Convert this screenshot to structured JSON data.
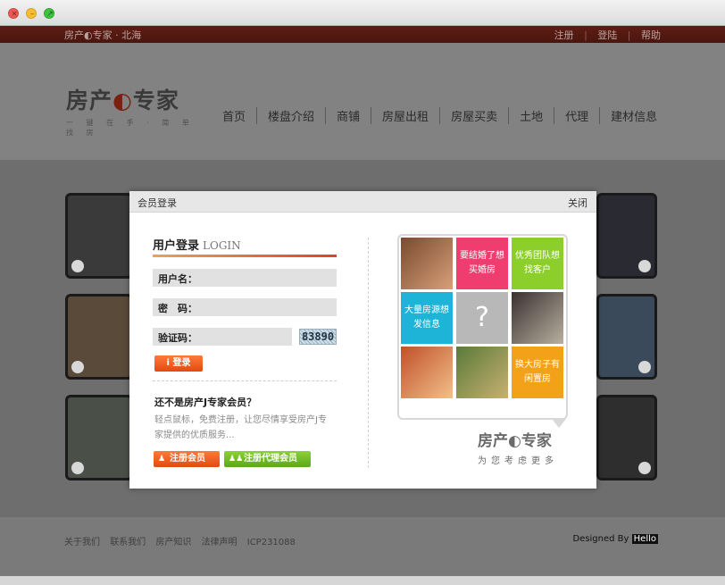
{
  "topbar": {
    "brand": "房产",
    "brand_bold": "专家",
    "city": "北海",
    "links": [
      "注册",
      "登陆",
      "帮助"
    ]
  },
  "header": {
    "logo_main": "房产",
    "logo_accent": "专家",
    "slogan": "一 键 在 手 · 简 单 找 房",
    "nav": [
      "首页",
      "楼盘介绍",
      "商铺",
      "房屋出租",
      "房屋买卖",
      "土地",
      "代理",
      "建材信息"
    ]
  },
  "modal": {
    "title": "会员登录",
    "close_label": "关闭",
    "login_title": "用户登录",
    "login_title_en": "LOGIN",
    "username_label": "用户名：",
    "password_label": "密　码：",
    "captcha_label": "验证码：",
    "captcha_value": "83890",
    "login_button": "登录",
    "not_member_title": "还不是房产J专家会员？",
    "not_member_desc": "轻点鼠标，免费注册，让您尽情享受房产J专家提供的优质服务...",
    "register_member_button": "注册会员",
    "register_agent_button": "注册代理会员",
    "promo_tiles": [
      "要结婚了想买婚房",
      "优秀团队想找客户",
      "大量房源想发信息",
      "?",
      "换大房子有闲置房"
    ],
    "brand_main": "房产",
    "brand_accent": "专家",
    "brand_slogan": "为您考虑更多"
  },
  "footer": {
    "links": [
      "关于我们",
      "联系我们",
      "房产知识",
      "法律声明",
      "ICP231088"
    ],
    "designed_by": "Designed By",
    "designer": "Hello"
  }
}
